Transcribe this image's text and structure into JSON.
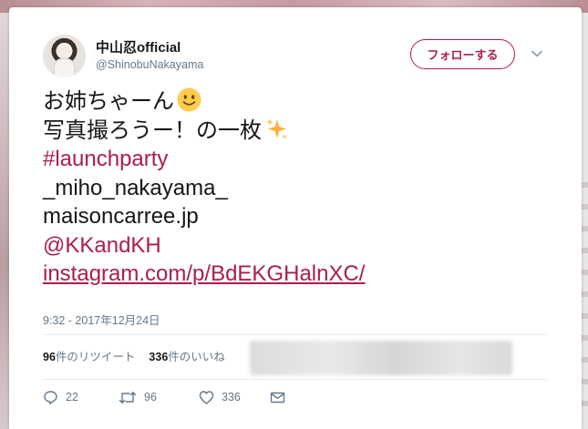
{
  "tweet": {
    "display_name": "中山忍official",
    "screen_name": "@ShinobuNakayama",
    "follow_label": "フォローする",
    "text_lines": [
      "お姉ちゃーん",
      "写真撮ろうー！の一枚"
    ],
    "hashtag": "#launchparty",
    "mention_user": "_miho_nakayama_",
    "plain_link": "maisoncarree.jp",
    "mention": "@KKandKH",
    "url": "instagram.com/p/BdEKGHalnXC/",
    "timestamp": "9:32 - 2017年12月24日",
    "emoji_1": "smiling-face-emoji",
    "emoji_2": "sparkles-emoji"
  },
  "stats": {
    "retweet_count": "96",
    "retweet_suffix": "件のリツイート",
    "like_count": "336",
    "like_suffix": "件のいいね"
  },
  "actions": {
    "reply_count": "22",
    "retweet_count": "96",
    "like_count": "336"
  },
  "colors": {
    "link": "#ab1d4d",
    "text": "#14171a",
    "secondary": "#657786"
  }
}
